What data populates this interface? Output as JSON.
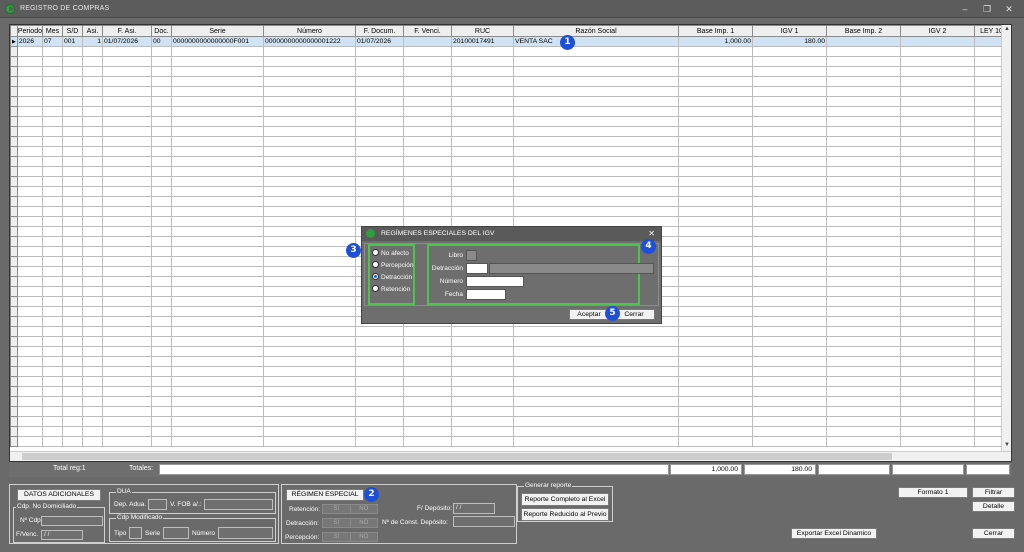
{
  "window": {
    "title": "REGISTRO DE COMPRAS"
  },
  "grid": {
    "columns": [
      {
        "label": "Periodo",
        "w": 12
      },
      {
        "label": "Mes",
        "w": 20
      },
      {
        "label": "S/D",
        "w": 20
      },
      {
        "label": "Asi.",
        "w": 20
      },
      {
        "label": "F. Asi.",
        "w": 49
      },
      {
        "label": "Doc.",
        "w": 20
      },
      {
        "label": "Serie",
        "w": 92
      },
      {
        "label": "Número",
        "w": 92
      },
      {
        "label": "F. Docum.",
        "w": 48
      },
      {
        "label": "F. Venci.",
        "w": 48
      },
      {
        "label": "RUC",
        "w": 62
      },
      {
        "label": "Razón Social",
        "w": 165
      },
      {
        "label": "Base Imp. 1",
        "w": 74
      },
      {
        "label": "IGV 1",
        "w": 74
      },
      {
        "label": "Base Imp. 2",
        "w": 74
      },
      {
        "label": "IGV 2",
        "w": 74
      },
      {
        "label": "LEY 10",
        "w": 34
      }
    ],
    "rows": [
      [
        "2026",
        "07",
        "001",
        "1",
        "01/07/2026",
        "00",
        "0000000000000000F001",
        "00000000000000001222",
        "01/07/2026",
        "",
        "20100017491",
        "VENTA SAC",
        "1,000.00",
        "180.00",
        "",
        "",
        ""
      ]
    ],
    "empty_rows": 40
  },
  "totals": {
    "total_reg_label": "Total reg:1",
    "totales_label": "Totales:",
    "base1": "1,000.00",
    "igv1": "180.00"
  },
  "datos_adicionales": {
    "button": "DATOS ADICIONALES",
    "cdp_no_domiciliado": "Cdp. No Domiciliado",
    "n_cdp_label": "Nº Cdp",
    "fvenc_label": "F/Venc.",
    "fvenc_value": "/  /",
    "dua_legend": "DUA",
    "dep_adua_label": "Dep. Adua.",
    "vfob_label": "V. FOB a/.:",
    "cdp_modificado": "Cdp Modificado",
    "tipo_label": "Tipo",
    "serie_label": "Serie",
    "numero_label": "Número"
  },
  "regimen": {
    "button": "RÉGIMEN ESPECIAL",
    "retencion_label": "Retención:",
    "detraccion_label": "Detracción:",
    "percepcion_label": "Percepción:",
    "si": "SI",
    "no": "NO",
    "fdeposito_label": "F/ Depósito:",
    "fdeposito_value": "/  /",
    "nconst_label": "Nº de Const. Depósito:"
  },
  "reporte": {
    "legend": "Generar reporte",
    "completo": "Reporte Completo al Excel",
    "reducido": "Reporte Reducido al Previo"
  },
  "actions": {
    "formato": "Formato 1",
    "filtrar": "Filtrar",
    "detalle": "Detalle",
    "exportar": "Exportar Excel Dinamico",
    "cerrar": "Cerrar"
  },
  "dialog": {
    "title": "REGÍMENES ESPECIALES DEL IGV",
    "options": [
      "No afecto",
      "Percepción",
      "Detracción",
      "Retención"
    ],
    "selected": "Detracción",
    "libro_label": "Libro",
    "detraccion_label": "Detracción",
    "numero_label": "Número",
    "fecha_label": "Fecha",
    "aceptar": "Aceptar",
    "cerrar": "Cerrar"
  },
  "badges": [
    "1",
    "2",
    "3",
    "4",
    "5"
  ]
}
